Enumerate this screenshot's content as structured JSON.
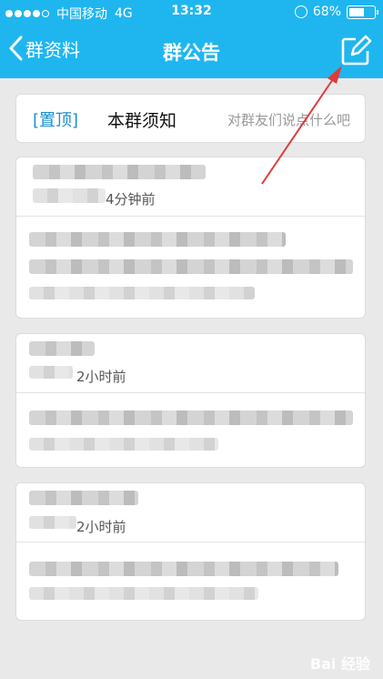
{
  "status_bar": {
    "carrier": "中国移动",
    "network": "4G",
    "time": "13:32",
    "battery": "68%",
    "battery_level": 0.68,
    "signal_bars": 4
  },
  "nav": {
    "back_label": "群资料",
    "title": "群公告",
    "back_icon": "chevron-left-icon",
    "edit_icon": "edit-icon"
  },
  "pinned": {
    "tag": "[置顶]",
    "title": "本群须知",
    "hint": "对群友们说点什么吧"
  },
  "announcements": [
    {
      "time": "4分钟前"
    },
    {
      "time": "2小时前"
    },
    {
      "time": "2小时前"
    }
  ],
  "watermark": "Bai 经验",
  "colors": {
    "header": "#1fb6f0",
    "background": "#e9e9e9",
    "annotation": "#e03a3a"
  }
}
